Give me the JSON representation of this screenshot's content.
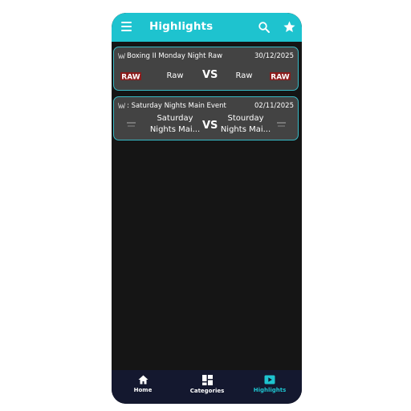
{
  "appbar": {
    "title": "Highlights",
    "menu_icon": "hamburger-menu-icon",
    "search_icon": "search-icon",
    "favorite_icon": "star-icon"
  },
  "events": [
    {
      "title": "Boxing II Monday Night Raw",
      "date": "30/12/2025",
      "team_a": "Raw",
      "team_b": "Raw",
      "vs": "VS",
      "logo_a": "RAW",
      "logo_b": "RAW"
    },
    {
      "title": ": Saturday Nights Main Event",
      "date": "02/11/2025",
      "team_a_line1": "Saturday",
      "team_a_line2": "Nights Mai...",
      "team_b_line1": "Stourday",
      "team_b_line2": "Nights Mai...",
      "vs": "VS"
    }
  ],
  "bottom_nav": [
    {
      "label": "Home",
      "icon": "home-icon",
      "active": false
    },
    {
      "label": "Categories",
      "icon": "grid-icon",
      "active": false
    },
    {
      "label": "Highlights",
      "icon": "play-icon",
      "active": true
    }
  ],
  "colors": {
    "accent": "#1ec3cf",
    "background": "#151515",
    "card": "#434343",
    "nav": "#14182f"
  }
}
